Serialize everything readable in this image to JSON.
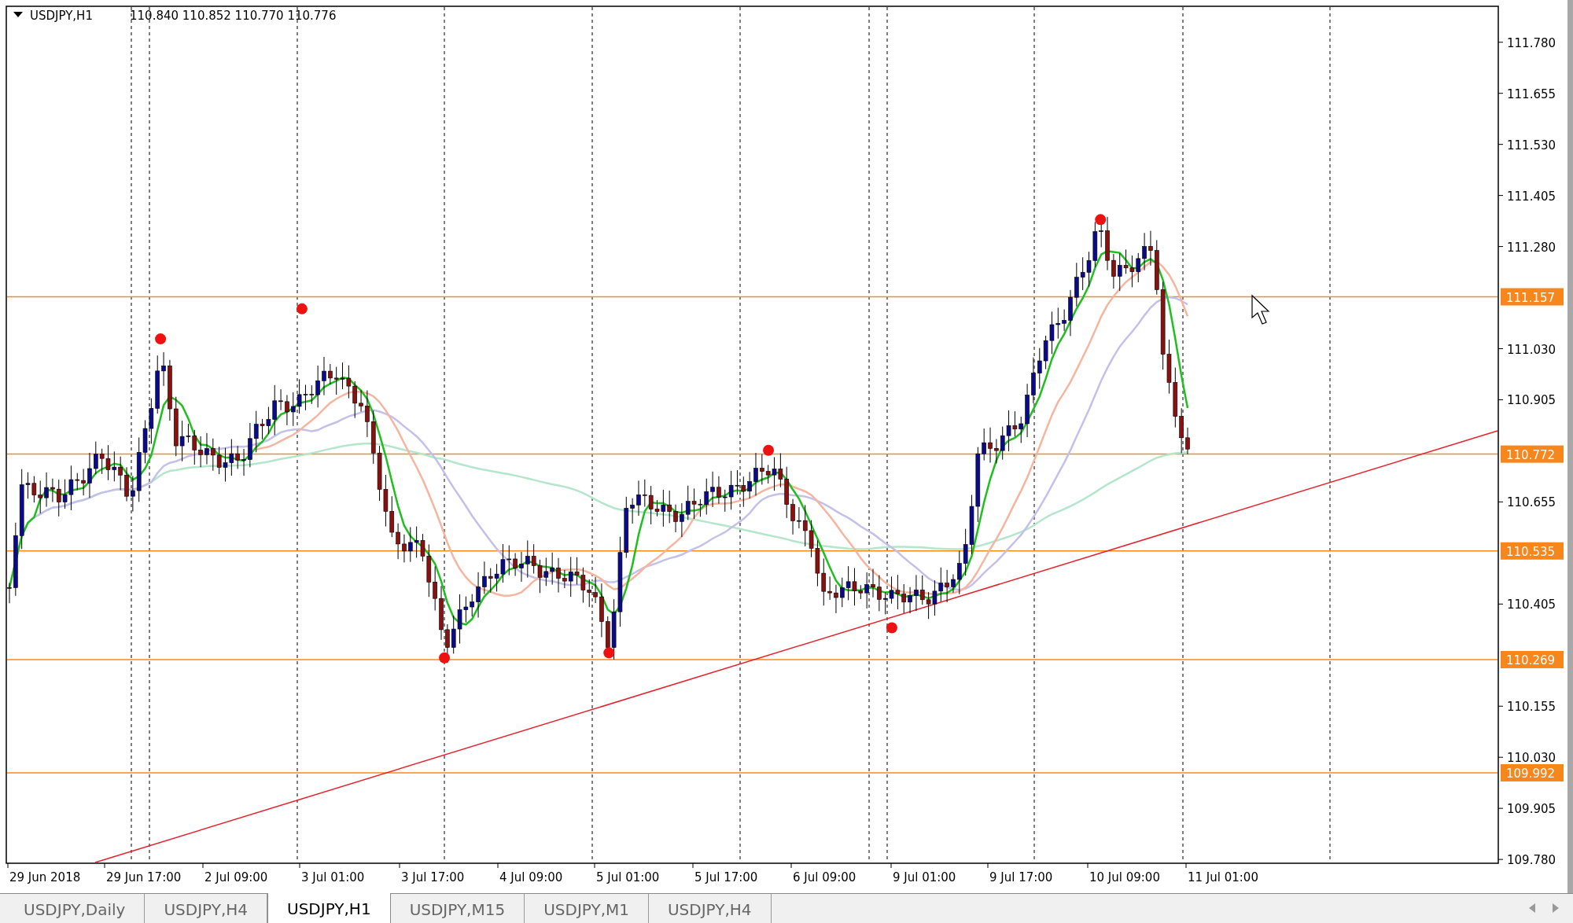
{
  "chart_header": {
    "symbol": "USDJPY,H1",
    "quote": "110.840 110.852 110.770 110.776"
  },
  "price_axis": {
    "ticks": [
      "111.780",
      "111.655",
      "111.530",
      "111.405",
      "111.280",
      "111.030",
      "110.905",
      "110.655",
      "110.405",
      "110.155",
      "110.030",
      "109.905",
      "109.780"
    ]
  },
  "level_lines": [
    {
      "label": "111.157"
    },
    {
      "label": "110.772"
    },
    {
      "label": "110.535"
    },
    {
      "label": "110.269"
    },
    {
      "label": "109.992"
    }
  ],
  "time_axis": {
    "labels": [
      "29 Jun 2018",
      "29 Jun 17:00",
      "2 Jul 09:00",
      "3 Jul 01:00",
      "3 Jul 17:00",
      "4 Jul 09:00",
      "5 Jul 01:00",
      "5 Jul 17:00",
      "6 Jul 09:00",
      "9 Jul 01:00",
      "9 Jul 17:00",
      "10 Jul 09:00",
      "11 Jul 01:00"
    ]
  },
  "tabs": [
    {
      "label": "USDJPY,Daily",
      "selected": false
    },
    {
      "label": "USDJPY,H4",
      "selected": false
    },
    {
      "label": "USDJPY,H1",
      "selected": true
    },
    {
      "label": "USDJPY,M15",
      "selected": false
    },
    {
      "label": "USDJPY,M1",
      "selected": false
    },
    {
      "label": "USDJPY,H4",
      "selected": false
    }
  ]
}
